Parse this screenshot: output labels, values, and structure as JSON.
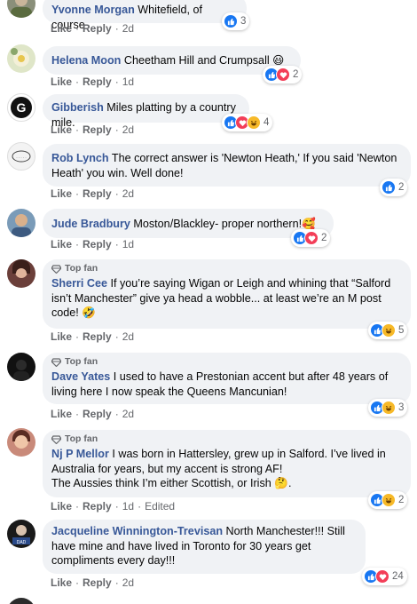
{
  "actions": {
    "like": "Like",
    "reply": "Reply",
    "edited": "Edited"
  },
  "badge_text": "Top fan",
  "comments": [
    {
      "author": "Yvonne Morgan",
      "text": "Whitefield, of course",
      "time": "2d",
      "reactions": [
        "like"
      ],
      "count": "3"
    },
    {
      "author": "Helena Moon",
      "text": "Cheetham Hill and Crumpsall 😃",
      "time": "1d",
      "reactions": [
        "like",
        "love"
      ],
      "count": "2"
    },
    {
      "author": "Gibberish",
      "text": "Miles platting by a country mile.",
      "time": "2d",
      "reactions": [
        "like",
        "love",
        "haha"
      ],
      "count": "4"
    },
    {
      "author": "Rob Lynch",
      "text": "The correct answer is 'Newton Heath,' If you said 'Newton Heath' you win. Well done!",
      "time": "2d",
      "reactions": [
        "like"
      ],
      "count": "2"
    },
    {
      "author": "Jude Bradbury",
      "text": "Moston/Blackley- proper northern!🥰",
      "time": "1d",
      "reactions": [
        "like",
        "love"
      ],
      "count": "2"
    },
    {
      "author": "Sherri Cee",
      "text": "If you’re saying Wigan or Leigh and whining that “Salford isn’t Manchester” give ya head a wobble... at least we’re an M post code! 🤣",
      "time": "2d",
      "reactions": [
        "like",
        "haha"
      ],
      "count": "5",
      "top_fan": true
    },
    {
      "author": "Dave Yates",
      "text": "I used to have a Prestonian accent but after 48 years of living here I now speak the Queens Mancunian!",
      "time": "2d",
      "reactions": [
        "like",
        "haha"
      ],
      "count": "3",
      "top_fan": true
    },
    {
      "author": "Nj P Mellor",
      "text": "I was born in Hattersley, grew up in Salford. I’ve lived in Australia for years, but my accent is strong AF!",
      "text2": "The Aussies think I’m either Scottish, or Irish 🤔.",
      "time": "1d",
      "edited": true,
      "reactions": [
        "like",
        "haha"
      ],
      "count": "2",
      "top_fan": true
    },
    {
      "author": "Jacqueline Winnington-Trevisan",
      "text": "North Manchester!!! Still have mine and have lived in Toronto for 30 years get compliments every day!!!",
      "time": "2d",
      "reactions": [
        "like",
        "love"
      ],
      "count": "24"
    }
  ],
  "colors": {
    "link": "#385898",
    "bubble": "#f0f2f5",
    "meta": "#65676b",
    "like": "#1877f2",
    "love": "#f33e58",
    "haha": "#f7b928"
  },
  "icons": {
    "top_fan": "diamond-icon",
    "like": "thumbs-up-icon",
    "love": "heart-icon",
    "haha": "laughing-face-icon"
  }
}
